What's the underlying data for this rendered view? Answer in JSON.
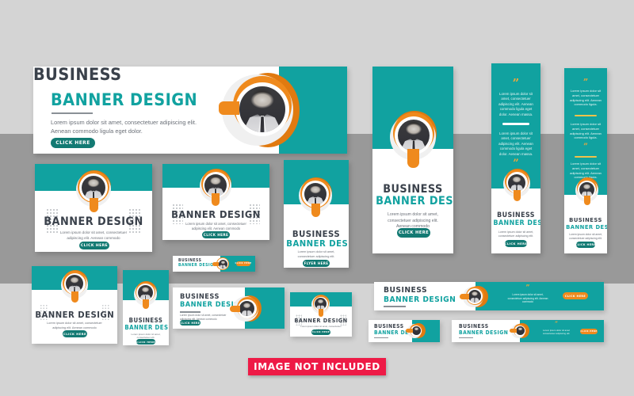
{
  "meta": {
    "background_light": "#d4d4d4",
    "background_dark": "#999999",
    "teal": "#11a2a0",
    "orange": "#ef8a1d",
    "dark_text": "#3a414b",
    "button_teal": "#137a73",
    "badge_red": "#ee1a46"
  },
  "strings": {
    "business": "BUSINESS",
    "banner_design": "BANNER DESIGN",
    "cta": "CLICK HERE",
    "cta_alt": "FLYER HERE",
    "quote": "“”",
    "lorem_long": "Lorem ipsum dolor sit amet, consectetuer adipiscing elit. Aenean commodo ligula eget dolor.",
    "lorem_short": "Lorem ipsum dolor sit amet, consectetuer adipiscing elit. Aenean commodo",
    "lorem_tiny": "Lorem ipsum dolor sit amet, consectetuer adipiscing elit.",
    "testimonial": "Lorem ipsum dolor sit amet, consectetuer adipiscing elit. Aenean commodo ligula eget dolor. Aenean massa.",
    "not_included": "IMAGE NOT INCLUDED"
  },
  "banners": {
    "hero_wide": {
      "title": "BUSINESS",
      "subtitle": "BANNER DESIGN",
      "body": "Lorem ipsum dolor sit amet, consectetuer adipiscing elit. Aenean commodo ligula eget dolor.",
      "cta": "CLICK HERE"
    },
    "hero_portrait": {
      "title": "BUSINESS",
      "subtitle": "BANNER DESIGN",
      "body": "Lorem ipsum dolor sit amet, consectetuer adipiscing elit. Aenean commodo",
      "cta": "CLICK HERE"
    },
    "sky_1": {
      "quote_top": "”",
      "text_1": "Lorem ipsum dolor sit amet, consectetuer adipiscing elit. Aenean commodo ligula eget dolor. Aenean massa.",
      "text_2": "Lorem ipsum dolor sit amet, consectetuer adipiscing elit. Aenean commodo ligula eget dolor. Aenean massa.",
      "quote_bottom": "”",
      "title": "BUSINESS",
      "subtitle": "BANNER DESIGN",
      "body": "Lorem ipsum dolor sit amet, consectetuer adipiscing elit.",
      "cta": "CLICK HERE"
    },
    "sky_2": {
      "quote_top": "”",
      "text_1": "Lorem ipsum dolor sit amet, consectetuer adipiscing elit. Aenean commodo ligula.",
      "text_2": "Lorem ipsum dolor sit amet, consectetuer adipiscing elit. Aenean commodo ligula.",
      "text_3": "Lorem ipsum dolor sit amet, consectetuer adipiscing elit. Aenean commodo ligula.",
      "title": "BUSINESS",
      "subtitle": "BANNER DESIGN",
      "body": "Lorem ipsum dolor sit amet, consectetuer adipiscing elit.",
      "cta": "CLICK HERE"
    },
    "card_a": {
      "title": "BANNER DESIGN",
      "body": "Lorem ipsum dolor sit amet, consectetuer adipiscing elit. Aenean commodo",
      "cta": "CLICK HERE"
    },
    "card_b": {
      "title": "BANNER DESIGN",
      "body": "Lorem ipsum dolor sit amet, consectetuer adipiscing elit. Aenean commodo",
      "cta": "CLICK HERE"
    },
    "card_c": {
      "title": "BUSINESS",
      "subtitle": "BANNER DESIGN",
      "body": "Lorem ipsum dolor sit amet, consectetuer adipiscing elit.",
      "cta": "FLYER HERE"
    },
    "card_d": {
      "title": "BANNER DESIGN",
      "body": "Lorem ipsum dolor sit amet, consectetuer adipiscing elit. Aenean commodo",
      "cta": "CLICK HERE"
    },
    "card_e": {
      "title": "BUSINESS",
      "subtitle": "BANNER DESIGN",
      "body": "Lorem ipsum dolor sit amet, consectetuer elit.",
      "cta": "CLICK HERE"
    },
    "strip_small": {
      "title": "BUSINESS",
      "subtitle": "BANNER DESIGN",
      "cta": "CLICK HERE"
    },
    "strip_wide": {
      "title": "BUSINESS",
      "subtitle": "BANNER DESIGN",
      "body": "Lorem ipsum dolor sit amet, consectetuer adipiscing elit. Aenean commodo",
      "cta": "CLICK HERE"
    },
    "card_f": {
      "title": "BANNER DESIGN",
      "body": "Lorem ipsum dolor sit amet, consectetuer adipiscing",
      "cta": "CLICK HERE"
    },
    "leaderboard": {
      "title": "BUSINESS",
      "subtitle": "BANNER DESIGN",
      "quote": "”",
      "body": "Lorem ipsum dolor sit amet, consectetuer adipiscing elit. Aenean commodo",
      "cta": "CLICK HERE"
    },
    "strip_tiny": {
      "title": "BUSINESS",
      "subtitle": "BANNER DESIGN"
    },
    "strip_mid": {
      "title": "BUSINESS",
      "subtitle": "BANNER DESIGN",
      "quote": "”",
      "body": "Lorem ipsum dolor sit amet consectetuer adipiscing elit.",
      "cta": "CLICK HERE"
    }
  }
}
